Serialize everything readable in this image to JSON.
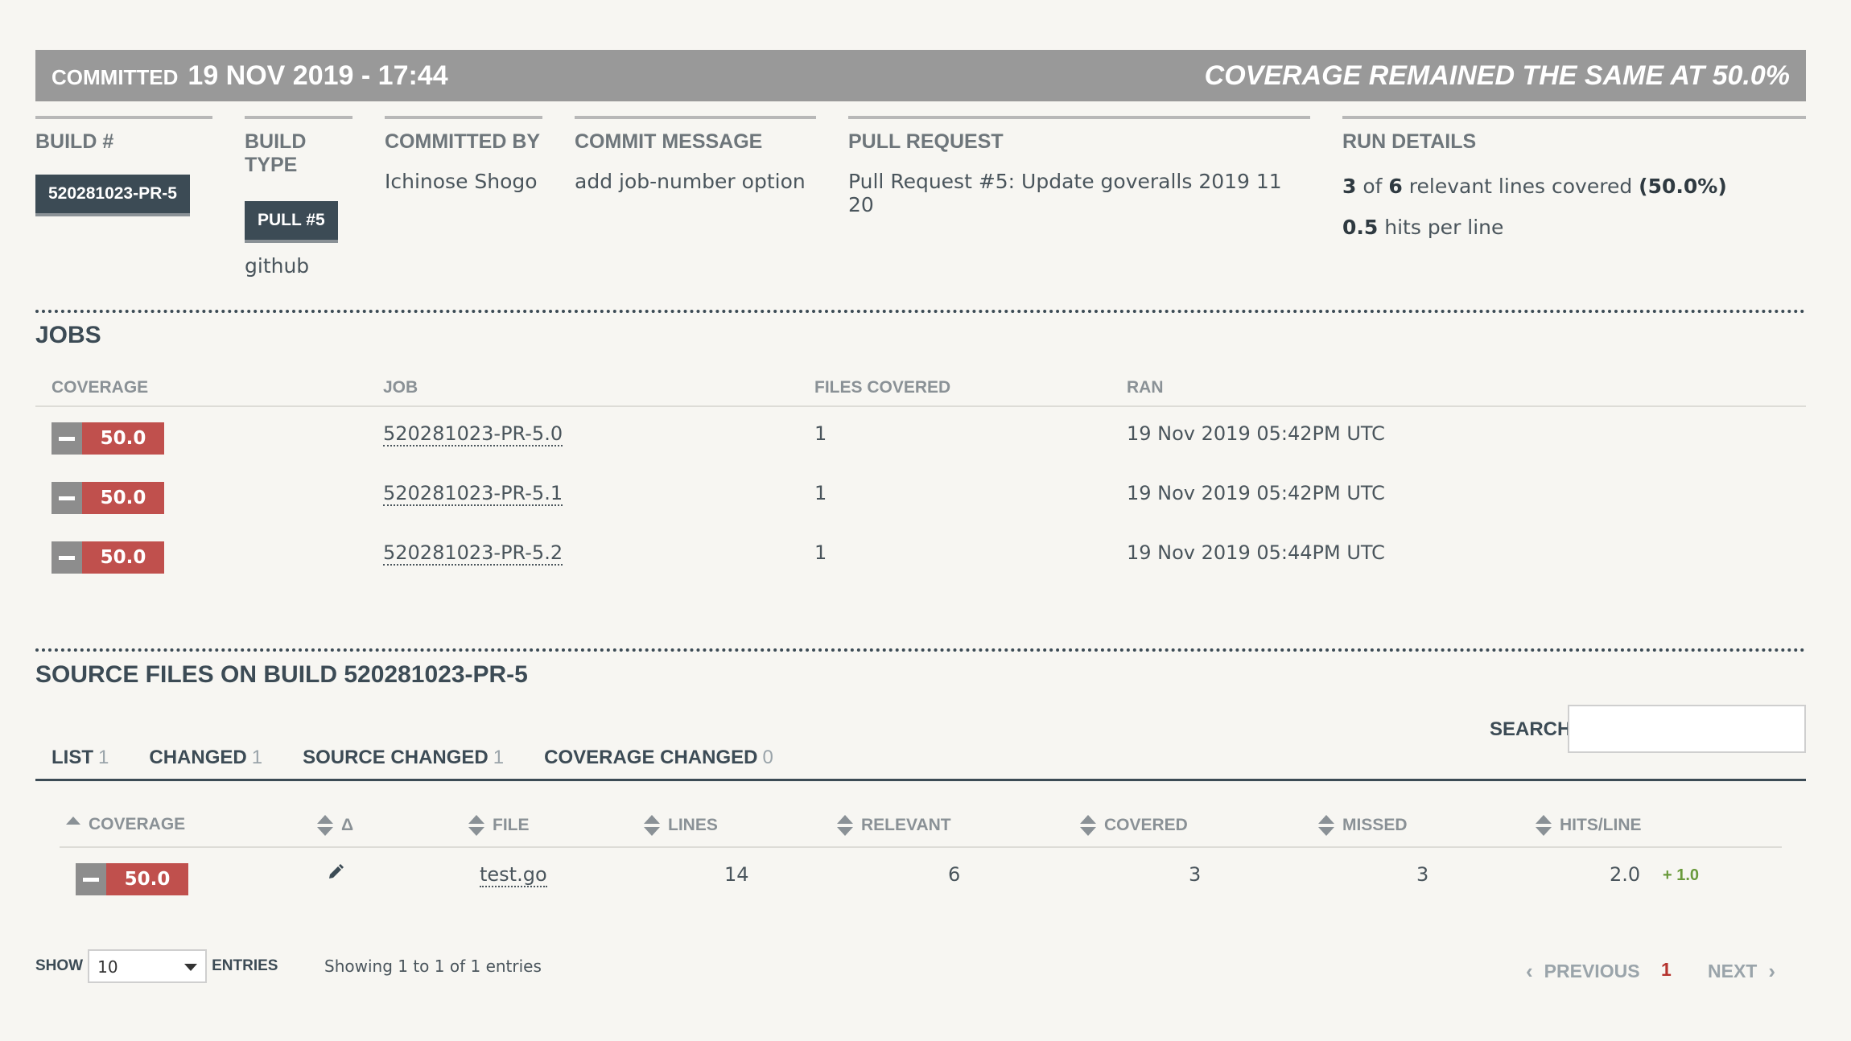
{
  "header": {
    "committed_label": "COMMITTED",
    "committed_date": "19 NOV 2019 - 17:44",
    "coverage_status": "COVERAGE REMAINED THE SAME AT 50.0%"
  },
  "info": {
    "build_title": "BUILD #",
    "build_value": "520281023-PR-5",
    "build_type_title": "BUILD TYPE",
    "build_type_badge": "PULL #5",
    "build_type_service": "github",
    "committed_by_title": "COMMITTED BY",
    "committed_by_value": "Ichinose Shogo",
    "commit_message_title": "COMMIT MESSAGE",
    "commit_message_value": "add job-number option",
    "pull_request_title": "PULL REQUEST",
    "pull_request_value": "Pull Request #5: Update goveralls 2019 11 20",
    "run_details_title": "RUN DETAILS",
    "run_lines_covered": "3",
    "run_of": "of",
    "run_lines_relevant": "6",
    "run_relevant_text": "relevant lines covered",
    "run_percent": "(50.0%)",
    "run_hits": "0.5",
    "run_hits_text": "hits per line"
  },
  "jobs": {
    "title": "JOBS",
    "columns": [
      "COVERAGE",
      "JOB",
      "FILES COVERED",
      "RAN"
    ],
    "rows": [
      {
        "coverage": "50.0",
        "job": "520281023-PR-5.0",
        "files": "1",
        "ran": "19 Nov 2019 05:42PM UTC"
      },
      {
        "coverage": "50.0",
        "job": "520281023-PR-5.1",
        "files": "1",
        "ran": "19 Nov 2019 05:42PM UTC"
      },
      {
        "coverage": "50.0",
        "job": "520281023-PR-5.2",
        "files": "1",
        "ran": "19 Nov 2019 05:44PM UTC"
      }
    ]
  },
  "source": {
    "title": "SOURCE FILES ON BUILD 520281023-PR-5",
    "tabs": [
      {
        "label": "LIST",
        "count": "1"
      },
      {
        "label": "CHANGED",
        "count": "1"
      },
      {
        "label": "SOURCE CHANGED",
        "count": "1"
      },
      {
        "label": "COVERAGE CHANGED",
        "count": "0"
      }
    ],
    "search_label": "SEARCH:",
    "search_value": "",
    "columns": [
      "COVERAGE",
      "Δ",
      "FILE",
      "LINES",
      "RELEVANT",
      "COVERED",
      "MISSED",
      "HITS/LINE"
    ],
    "rows": [
      {
        "coverage": "50.0",
        "file": "test.go",
        "lines": "14",
        "relevant": "6",
        "covered": "3",
        "missed": "3",
        "hits": "2.0",
        "hits_change": "+ 1.0"
      }
    ]
  },
  "footer": {
    "show_label": "SHOW",
    "entries_value": "10",
    "entries_label": "ENTRIES",
    "showing_text": "Showing 1 to 1 of 1 entries",
    "previous": "PREVIOUS",
    "current_page": "1",
    "next": "NEXT"
  },
  "colors": {
    "header_bg": "#999999",
    "dark": "#3c4b55",
    "coverage_red": "#c0504d",
    "positive_green": "#6a9a3c",
    "current_page_red": "#b5332e"
  }
}
